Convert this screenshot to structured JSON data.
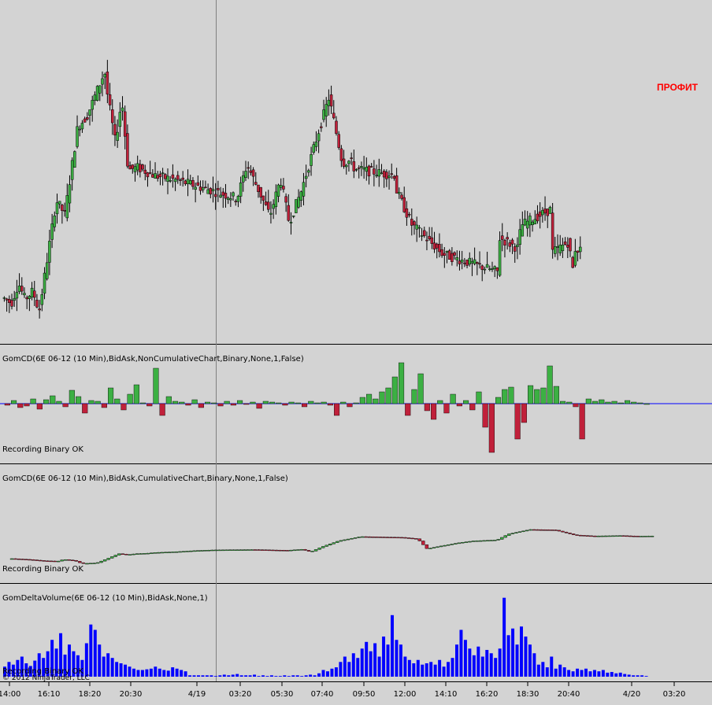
{
  "colors": {
    "background": "#d3d3d3",
    "up": "#3cb043",
    "down": "#c0203a",
    "wick": "#000000",
    "zero_line": "#0000ff",
    "volume": "#0000ff",
    "annotation": "#ff0000",
    "panel_border": "#000000"
  },
  "annotation": "ПРОФИТ",
  "copyright": "© 2012 NinjaTrader, LLC",
  "chart_data": [
    {
      "type": "candlestick",
      "panel": "price",
      "x": [
        "14:00",
        "16:10",
        "18:20",
        "20:30",
        "4/19",
        "03:20",
        "05:30",
        "07:40",
        "09:50",
        "12:00",
        "14:10",
        "16:20",
        "18:30",
        "20:40",
        "4/20",
        "03:20"
      ],
      "series": [
        {
          "values": [
            [
              12.1,
              0.6
            ],
            [
              10.6,
              1.6
            ],
            [
              16.7,
              2.6
            ],
            [
              11.8,
              3.5
            ],
            [
              14.3,
              4.6
            ],
            [
              8.2,
              5.5
            ],
            [
              41.8,
              7.9
            ],
            [
              37.5,
              9.1
            ],
            [
              63.9,
              10.9
            ],
            [
              67.2,
              12.2
            ],
            [
              80.7,
              14.7
            ],
            [
              73.6,
              15.1
            ],
            [
              59.3,
              16.2
            ],
            [
              72.4,
              17.1
            ],
            [
              51.0,
              18.0
            ],
            [
              51.7,
              19.3
            ],
            [
              49.2,
              21.8
            ],
            [
              47.7,
              25.1
            ],
            [
              42.4,
              33.3
            ],
            [
              52.7,
              34.7
            ],
            [
              37.1,
              37.9
            ],
            [
              48.2,
              39.4
            ],
            [
              35.1,
              40.6
            ],
            [
              44.5,
              42.3
            ],
            [
              63.0,
              44.8
            ],
            [
              72.9,
              46.2
            ],
            [
              53.1,
              48.1
            ],
            [
              53.7,
              49.2
            ],
            [
              51.3,
              49.8
            ],
            [
              49.8,
              54.0
            ],
            [
              49.5,
              55.6
            ],
            [
              52.4,
              54.1
            ],
            [
              34.5,
              57.8
            ],
            [
              25.5,
              62.2
            ],
            [
              20.1,
              69.9
            ],
            [
              26.9,
              66.9
            ],
            [
              33.1,
              67.9
            ],
            [
              27.3,
              72.7
            ],
            [
              34.2,
              73.2
            ],
            [
              39.2,
              77.5
            ],
            [
              25.9,
              77.6
            ],
            [
              24.0,
              76.1
            ],
            [
              29.1,
              79.8
            ],
            [
              17.9,
              80.7
            ],
            [
              21.7,
              78.8
            ],
            [
              21.4,
              78.3
            ],
            [
              22.0,
              75.6
            ],
            [
              28.8,
              77.6
            ],
            [
              26.7,
              81.5
            ],
            [
              34.8,
              81.2
            ],
            [
              35.1,
              79.1
            ]
          ]
        }
      ]
    },
    {
      "type": "bar",
      "panel": "delta",
      "title": "GomCD(6E 06-12 (10 Min),BidAsk,NonCumulativeChart,Binary,None,1,False)",
      "status": "Recording Binary OK",
      "values": [
        -2,
        4,
        -5,
        -3,
        6,
        -7,
        5,
        10,
        3,
        -4,
        17,
        9,
        -12,
        4,
        3,
        -5,
        20,
        6,
        -8,
        12,
        24,
        1,
        -3,
        45,
        -15,
        9,
        3,
        2,
        -2,
        5,
        -5,
        2,
        1,
        -3,
        3,
        -2,
        4,
        -1,
        2,
        -6,
        3,
        2,
        1,
        -2,
        2,
        1,
        -4,
        3,
        1,
        2,
        -2,
        -15,
        2,
        -4,
        1,
        8,
        12,
        6,
        15,
        20,
        34,
        52,
        -15,
        18,
        38,
        -9,
        -20,
        4,
        -12,
        12,
        -3,
        4,
        -8,
        15,
        -30,
        -62,
        8,
        18,
        21,
        -45,
        -24,
        23,
        18,
        20,
        48,
        22,
        3,
        2,
        -4,
        -45,
        6,
        3,
        5,
        2,
        3,
        1,
        4,
        2,
        1,
        0
      ]
    },
    {
      "type": "candlestick",
      "panel": "cumulative",
      "title": "GomCD(6E 06-12 (10 Min),BidAsk,CumulativeChart,Binary,None,1,False)",
      "status": "Recording Binary OK",
      "series": [
        {
          "values": [
            [
              -120,
              0.3
            ],
            [
              -125,
              1.3
            ],
            [
              -131,
              2.0
            ],
            [
              -133,
              2.8
            ],
            [
              -124,
              3.1
            ],
            [
              -130,
              3.7
            ],
            [
              -145,
              4.1
            ],
            [
              -142,
              4.9
            ],
            [
              -123,
              5.4
            ],
            [
              -95,
              6.1
            ],
            [
              -100,
              6.6
            ],
            [
              -95,
              7.0
            ],
            [
              -93,
              7.6
            ],
            [
              -89,
              8.1
            ],
            [
              -87,
              8.7
            ],
            [
              -84,
              9.4
            ],
            [
              -80,
              10.1
            ],
            [
              -76,
              11.2
            ],
            [
              -75,
              12.3
            ],
            [
              -74,
              13.4
            ],
            [
              -76,
              14.3
            ],
            [
              -78,
              15.2
            ],
            [
              -73,
              16.0
            ],
            [
              -85,
              16.5
            ],
            [
              -60,
              17.1
            ],
            [
              -30,
              18.0
            ],
            [
              -8,
              19.2
            ],
            [
              -10,
              20.3
            ],
            [
              -12,
              21.4
            ],
            [
              -20,
              22.3
            ],
            [
              -70,
              22.8
            ],
            [
              -55,
              23.6
            ],
            [
              -40,
              24.5
            ],
            [
              -30,
              25.3
            ],
            [
              -25,
              26.6
            ],
            [
              5,
              27.2
            ],
            [
              28,
              28.4
            ],
            [
              26,
              29.7
            ],
            [
              0,
              30.8
            ],
            [
              -5,
              31.8
            ],
            [
              -4,
              32.6
            ],
            [
              -3,
              33.3
            ],
            [
              -6,
              34.2
            ],
            [
              -5,
              35.0
            ]
          ]
        }
      ]
    },
    {
      "type": "bar",
      "panel": "volume",
      "title": "GomDeltaVolume(6E 06-12 (10 Min),BidAsk,None,1)",
      "status": "Recording Binary OK",
      "values": [
        15,
        22,
        18,
        25,
        30,
        20,
        16,
        24,
        35,
        28,
        38,
        55,
        42,
        65,
        33,
        48,
        38,
        32,
        25,
        50,
        78,
        70,
        48,
        30,
        35,
        28,
        22,
        20,
        18,
        15,
        12,
        10,
        10,
        11,
        12,
        15,
        12,
        10,
        9,
        14,
        12,
        10,
        8,
        2,
        2,
        2,
        2,
        2,
        2,
        1,
        2,
        3,
        2,
        3,
        4,
        2,
        2,
        2,
        3,
        1,
        2,
        1,
        2,
        1,
        1,
        2,
        1,
        2,
        2,
        1,
        2,
        3,
        2,
        5,
        10,
        8,
        12,
        14,
        22,
        30,
        22,
        35,
        28,
        42,
        52,
        38,
        50,
        30,
        60,
        48,
        92,
        55,
        48,
        30,
        25,
        20,
        25,
        18,
        20,
        22,
        18,
        25,
        15,
        22,
        28,
        48,
        70,
        55,
        42,
        32,
        45,
        30,
        40,
        35,
        28,
        42,
        118,
        62,
        72,
        48,
        75,
        60,
        48,
        35,
        18,
        22,
        14,
        30,
        12,
        18,
        14,
        10,
        8,
        12,
        10,
        12,
        8,
        10,
        8,
        10,
        6,
        7,
        5,
        6,
        4,
        3,
        2,
        2,
        2,
        1
      ]
    }
  ]
}
